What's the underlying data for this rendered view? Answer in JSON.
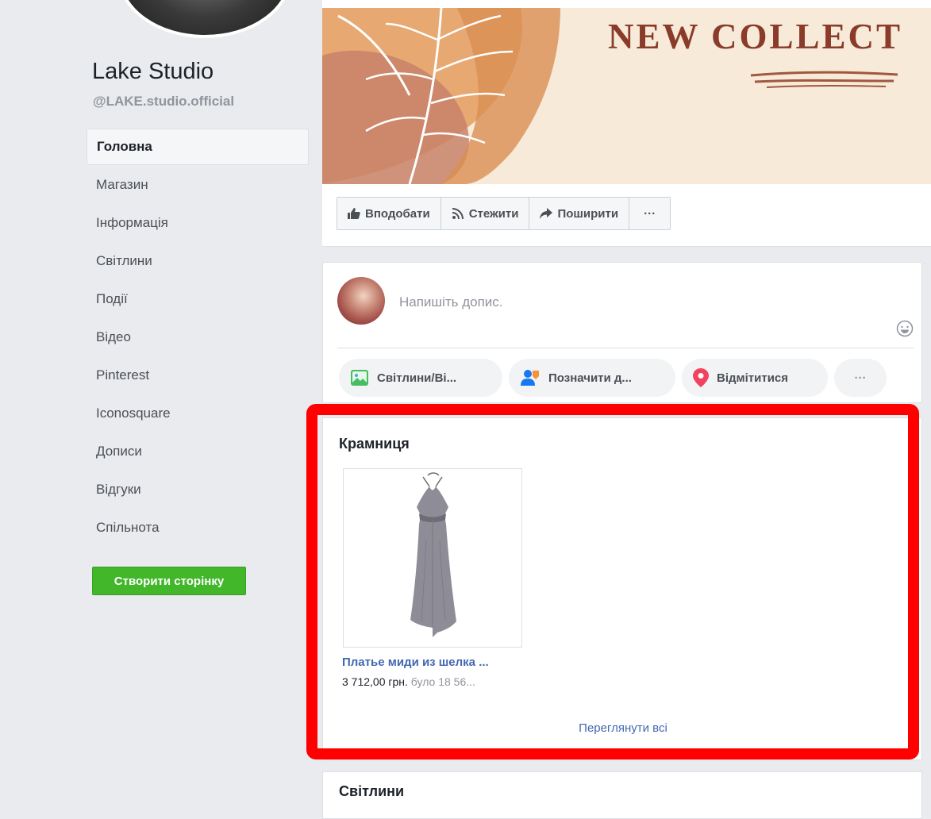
{
  "page": {
    "name": "Lake Studio",
    "handle": "@LAKE.studio.official"
  },
  "sidebar": {
    "items": [
      {
        "label": "Головна",
        "active": true
      },
      {
        "label": "Магазин"
      },
      {
        "label": "Інформація"
      },
      {
        "label": "Світлини"
      },
      {
        "label": "Події"
      },
      {
        "label": "Відео"
      },
      {
        "label": "Pinterest"
      },
      {
        "label": "Iconosquare"
      },
      {
        "label": "Дописи"
      },
      {
        "label": "Відгуки"
      },
      {
        "label": "Спільнота"
      }
    ],
    "create_page_label": "Створити сторінку"
  },
  "cover": {
    "title": "NEW COLLECT"
  },
  "actions": {
    "like": "Вподобати",
    "follow": "Стежити",
    "share": "Поширити",
    "more": "···"
  },
  "composer": {
    "placeholder": "Напишіть допис.",
    "photo_video": "Світлини/Ві...",
    "tag_friends": "Позначити д...",
    "check_in": "Відмітитися",
    "more": "···"
  },
  "shop": {
    "title": "Крамниця",
    "product": {
      "name": "Платье миди из шелка ...",
      "price": "3 712,00 грн.",
      "old_price": "було 18 56..."
    },
    "see_all": "Переглянути всі"
  },
  "photos": {
    "title": "Світлини"
  },
  "colors": {
    "background": "#e9ebee",
    "link": "#4267b2",
    "create_button": "#42b72a",
    "highlight": "#ff0000",
    "cover_title": "#8a3b2a"
  }
}
